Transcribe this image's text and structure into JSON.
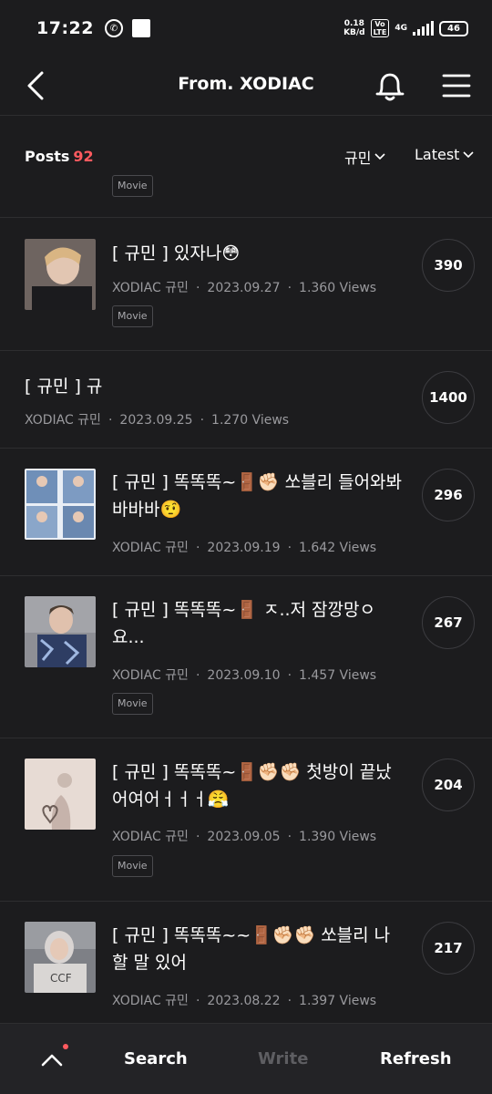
{
  "status": {
    "time": "17:22",
    "net_speed_top": "0.18",
    "net_speed_bottom": "KB/d",
    "volte_top": "Vo",
    "volte_bottom": "LTE",
    "net_type": "4G",
    "battery": "46"
  },
  "header": {
    "title": "From. XODIAC"
  },
  "filter": {
    "posts_label": "Posts",
    "posts_count": "92",
    "member": "규민",
    "sort": "Latest"
  },
  "partial_item": {
    "tag": "Movie"
  },
  "posts": [
    {
      "title": "[ 규민 ] 있자나😳",
      "author": "XODIAC 규민",
      "date": "2023.09.27",
      "views": "1.360 Views",
      "tag": "Movie",
      "count": "390",
      "thumb_color": "#8a7b70"
    },
    {
      "title": "[ 규민 ] 규",
      "author": "XODIAC 규민",
      "date": "2023.09.25",
      "views": "1.270 Views",
      "tag": "",
      "count": "1400",
      "thumb_color": ""
    },
    {
      "title": "[ 규민 ] 똑똑똑~🚪✊🏻 쏘블리 들어와봐바바바🤨",
      "author": "XODIAC 규민",
      "date": "2023.09.19",
      "views": "1.642 Views",
      "tag": "",
      "count": "296",
      "thumb_color": "#6f8fb8"
    },
    {
      "title": "[ 규민 ] 똑똑똑~🚪 ㅈ..저 잠깡망ㅇ요...",
      "author": "XODIAC 규민",
      "date": "2023.09.10",
      "views": "1.457 Views",
      "tag": "Movie",
      "count": "267",
      "thumb_color": "#4b5878"
    },
    {
      "title": "[ 규민 ] 똑똑똑~🚪✊🏻✊🏻 첫방이 끝났어여어ㅓㅓㅓ😤",
      "author": "XODIAC 규민",
      "date": "2023.09.05",
      "views": "1.390 Views",
      "tag": "Movie",
      "count": "204",
      "thumb_color": "#d8c8bf"
    },
    {
      "title": "[ 규민 ] 똑똑똑~~🚪✊🏻✊🏻 쏘블리 나 할 말 있어",
      "author": "XODIAC 규민",
      "date": "2023.08.22",
      "views": "1.397 Views",
      "tag": "",
      "count": "217",
      "thumb_color": "#a7a9ad"
    }
  ],
  "bottom_bar": {
    "search": "Search",
    "write": "Write",
    "refresh": "Refresh"
  },
  "colors": {
    "background": "#1c1c1e",
    "accent_red": "#ff5a5f",
    "meta_gray": "#9a9a9e"
  }
}
